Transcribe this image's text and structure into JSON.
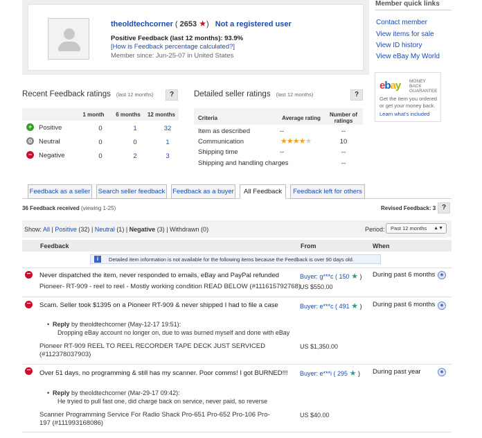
{
  "profile": {
    "username": "theoldtechcorner",
    "score": "2653",
    "not_registered": "Not a registered user",
    "positive_feedback": "Positive Feedback (last 12 months): 93.9%",
    "how_calculated": "[How is Feedback percentage calculated?]",
    "member_since": "Member since: Jun-25-07 in United States"
  },
  "quick_links": {
    "title": "Member quick links",
    "items": [
      "Contact member",
      "View items for sale",
      "View ID history",
      "View eBay My World"
    ]
  },
  "ebay_promo": {
    "logo": "ebay",
    "badge": "MONEY BACK GUARANTEE",
    "text": "Get the item you ordered or get your money back.",
    "more": "Learn what's included"
  },
  "recent": {
    "title": "Recent Feedback ratings",
    "period": "(last 12 months)",
    "help": "?",
    "columns": [
      "1 month",
      "6 months",
      "12 months"
    ],
    "rows": [
      {
        "label": "Positive",
        "values": [
          "0",
          "1",
          "32"
        ]
      },
      {
        "label": "Neutral",
        "values": [
          "0",
          "0",
          "1"
        ]
      },
      {
        "label": "Negative",
        "values": [
          "0",
          "2",
          "3"
        ]
      }
    ],
    "colors": {
      "positive": "#3a9a2c",
      "neutral": "#8a8a8a",
      "negative": "#c8102e"
    }
  },
  "detailed": {
    "title": "Detailed seller ratings",
    "period": "(last 12 months)",
    "help": "?",
    "col_criteria": "Criteria",
    "col_avg": "Average rating",
    "col_num": "Number of ratings",
    "rows": [
      {
        "label": "Item as described",
        "avg": "--",
        "num": "--",
        "stars": 0
      },
      {
        "label": "Communication",
        "avg": "",
        "num": "10",
        "stars": 4
      },
      {
        "label": "Shipping time",
        "avg": "--",
        "num": "--",
        "stars": 0
      },
      {
        "label": "Shipping and handling charges",
        "avg": "--",
        "num": "--",
        "stars": 0
      }
    ]
  },
  "tabs": [
    "Feedback as a seller",
    "Search seller feedback",
    "Feedback as a buyer",
    "All Feedback",
    "Feedback left for others"
  ],
  "received": {
    "label": "36 Feedback received",
    "viewing": "(viewing 1-25)",
    "revised": "Revised Feedback: 3",
    "help": "?"
  },
  "filter": {
    "show": "Show:",
    "all": "All",
    "positive": "Positive",
    "positive_count": "(32)",
    "neutral": "Neutral",
    "neutral_count": "(1)",
    "negative": "Negative",
    "negative_count": "(3)",
    "withdrawn": "Withdrawn (0)",
    "period_label": "Period:",
    "period_value": "Past 12 months"
  },
  "columns": {
    "feedback": "Feedback",
    "from": "From",
    "when": "When"
  },
  "info": "Detailed item information is not available for the following items because the Feedback is over 90 days old.",
  "entries": [
    {
      "comment": "Never dispatched the item, never responded to emails, eBay and PayPal refunded",
      "item": "Pioneer- RT-909 - reel to reel - Mostly working condition READ BELOW (#111615792768)",
      "buyer": "Buyer: g***c ( 150",
      "price": "US $550.00",
      "when": "During past 6 months"
    },
    {
      "comment": "Scam. Seller took $1395 on a Pioneer RT-909 & never shipped I had to file a case",
      "reply_by": "Reply",
      "reply_meta": "by theoldtechcorner (May-12-17 19:51):",
      "reply_text": "Dropping eBay account no longer on, due to was burned myself and done with eBay",
      "item": "Pioneer RT-909 REEL TO REEL RECORDER TAPE DECK JUST SERVICED (#112378037903)",
      "buyer": "Buyer: e***c ( 491",
      "price": "US $1,350.00",
      "when": "During past 6 months"
    },
    {
      "comment": "Over 51 days, no programming & still has my scanner. Poor comms! I got BURNED!!!",
      "reply_by": "Reply",
      "reply_meta": "by theoldtechcorner (Mar-29-17 09:42):",
      "reply_text": "He tryied to pull fast one, did charge back on service, never paid, so reverse",
      "item": "Scanner Programming Service For Radio Shack Pro-651 Pro-652 Pro-106 Pro-197 (#111993168086)",
      "buyer": "Buyer: e***i ( 295",
      "price": "US $40.00",
      "when": "During past year"
    }
  ]
}
